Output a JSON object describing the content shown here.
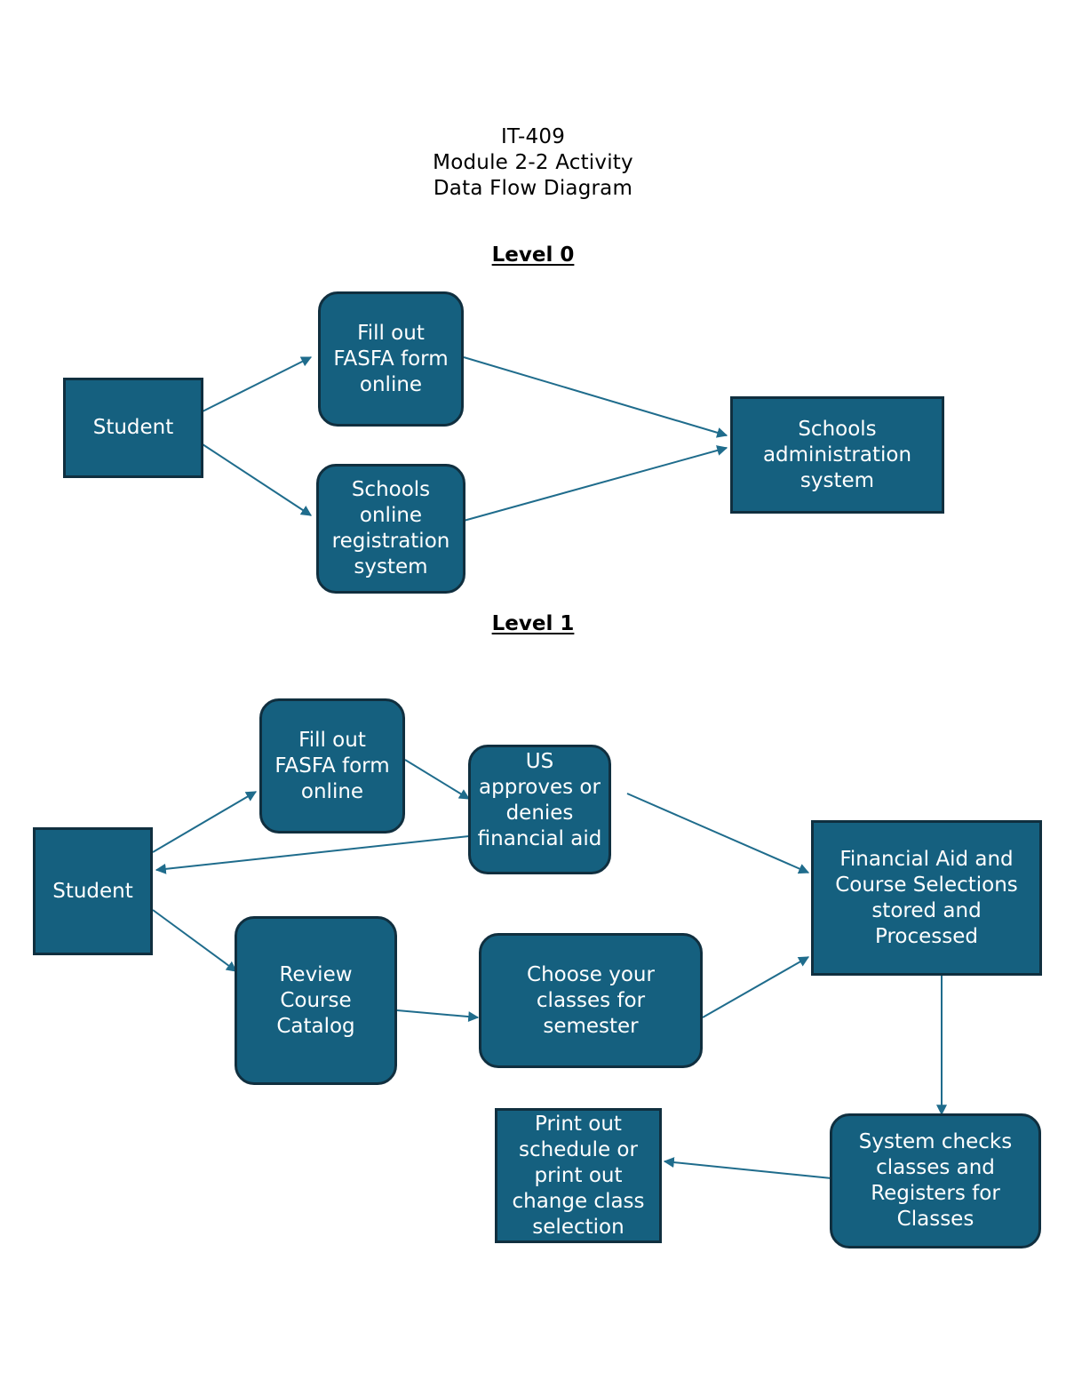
{
  "document": {
    "title_lines": [
      "IT-409",
      "Module 2-2 Activity",
      "Data Flow Diagram"
    ],
    "title_line_1": "IT-409",
    "title_line_2": "Module 2-2 Activity",
    "title_line_3": "Data Flow Diagram"
  },
  "colors": {
    "node_fill": "#15607F",
    "node_border": "#102F3F",
    "node_text": "#FFFFFF",
    "connector": "#1F6C8C",
    "page_background": "#FFFFFF",
    "heading_text": "#000000"
  },
  "sections": [
    {
      "id": "level0",
      "heading": "Level 0"
    },
    {
      "id": "level1",
      "heading": "Level 1"
    }
  ],
  "level0": {
    "heading": "Level 0",
    "nodes": [
      {
        "id": "l0-student",
        "label": "Student",
        "shape": "rectangle",
        "role": "external-entity"
      },
      {
        "id": "l0-fasfa",
        "label": "Fill out FASFA form online",
        "shape": "rounded-rectangle",
        "role": "process"
      },
      {
        "id": "l0-registration",
        "label": "Schools online registration system",
        "shape": "rounded-rectangle",
        "role": "process"
      },
      {
        "id": "l0-admin",
        "label": "Schools administration system",
        "shape": "rectangle",
        "role": "data-store"
      }
    ],
    "edges": [
      {
        "from": "l0-student",
        "to": "l0-fasfa"
      },
      {
        "from": "l0-student",
        "to": "l0-registration"
      },
      {
        "from": "l0-fasfa",
        "to": "l0-admin"
      },
      {
        "from": "l0-registration",
        "to": "l0-admin"
      }
    ]
  },
  "level1": {
    "heading": "Level 1",
    "nodes": [
      {
        "id": "l1-student",
        "label": "Student",
        "shape": "rectangle",
        "role": "external-entity"
      },
      {
        "id": "l1-fasfa",
        "label": "Fill out FASFA form online",
        "shape": "rounded-rectangle",
        "role": "process"
      },
      {
        "id": "l1-approve",
        "label": "US approves or denies financial aid",
        "shape": "rounded-rectangle",
        "role": "process"
      },
      {
        "id": "l1-stored",
        "label": "Financial Aid and Course Selections stored and Processed",
        "shape": "rectangle",
        "role": "data-store"
      },
      {
        "id": "l1-catalog",
        "label": "Review Course Catalog",
        "shape": "rounded-rectangle",
        "role": "process"
      },
      {
        "id": "l1-choose",
        "label": "Choose your classes for semester",
        "shape": "rounded-rectangle",
        "role": "process"
      },
      {
        "id": "l1-print",
        "label": "Print out schedule or print out change class selection",
        "shape": "rectangle",
        "role": "process"
      },
      {
        "id": "l1-register",
        "label": "System checks classes and Registers for Classes",
        "shape": "rounded-rectangle",
        "role": "process"
      }
    ],
    "edges": [
      {
        "from": "l1-student",
        "to": "l1-fasfa"
      },
      {
        "from": "l1-fasfa",
        "to": "l1-approve"
      },
      {
        "from": "l1-approve",
        "to": "l1-student"
      },
      {
        "from": "l1-approve",
        "to": "l1-stored"
      },
      {
        "from": "l1-student",
        "to": "l1-catalog"
      },
      {
        "from": "l1-catalog",
        "to": "l1-choose"
      },
      {
        "from": "l1-choose",
        "to": "l1-stored"
      },
      {
        "from": "l1-stored",
        "to": "l1-register"
      },
      {
        "from": "l1-register",
        "to": "l1-print"
      }
    ]
  }
}
